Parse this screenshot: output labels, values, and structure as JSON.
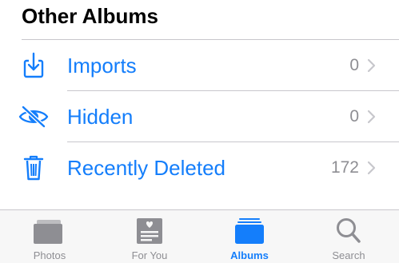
{
  "section": {
    "title": "Other Albums"
  },
  "albums": [
    {
      "label": "Imports",
      "count": "0",
      "icon": "import-icon"
    },
    {
      "label": "Hidden",
      "count": "0",
      "icon": "hidden-eye-icon"
    },
    {
      "label": "Recently Deleted",
      "count": "172",
      "icon": "trash-icon"
    }
  ],
  "tabbar": {
    "tabs": [
      {
        "label": "Photos",
        "icon": "photos-icon",
        "active": false
      },
      {
        "label": "For You",
        "icon": "for-you-icon",
        "active": false
      },
      {
        "label": "Albums",
        "icon": "albums-icon",
        "active": true
      },
      {
        "label": "Search",
        "icon": "search-icon",
        "active": false
      }
    ]
  },
  "colors": {
    "accent": "#147efb",
    "inactive": "#8e8e93",
    "separator": "#c8c7cc"
  }
}
